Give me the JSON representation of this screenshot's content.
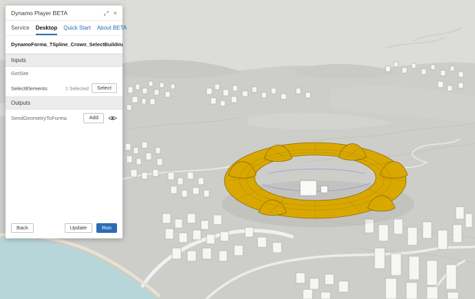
{
  "panel": {
    "title": "Dynamo Player BETA",
    "icons": {
      "expand": "⤢",
      "close": "×"
    },
    "tabs": [
      {
        "label": "Service"
      },
      {
        "label": "Desktop"
      },
      {
        "label": "Quick Start"
      },
      {
        "label": "About BETA"
      }
    ],
    "script_name": "DynamoForma_TSpline_Crown_SelectBuilding",
    "inputs_header": "Inputs",
    "outputs_header": "Outputs",
    "rows": {
      "getsite": {
        "label": "GetSite"
      },
      "select_elements": {
        "label": "SelectElements",
        "status": "1 Selected",
        "button": "Select"
      },
      "send_geometry": {
        "label": "SendGeometryToForma",
        "button": "Add"
      }
    },
    "footer": {
      "back": "Back",
      "update": "Update",
      "run": "Run"
    }
  },
  "colors": {
    "accent": "#2a6db5",
    "crown": "#d9a800",
    "water": "#b6d6d9",
    "terrain": "#cdcdca"
  }
}
